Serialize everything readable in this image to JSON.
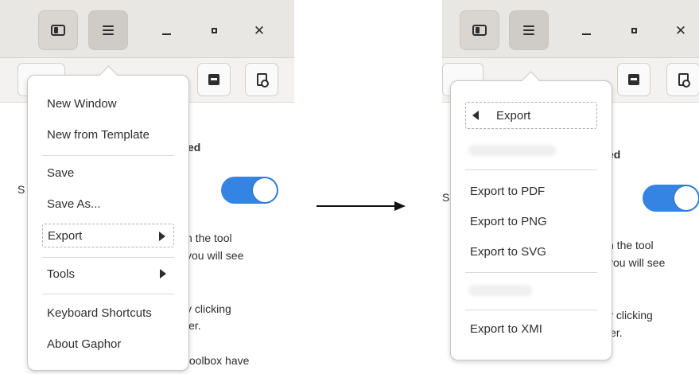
{
  "left": {
    "bg": {
      "text_ed": "ed",
      "text_s": "S",
      "text_tool": "n the tool",
      "text_see": "you will see",
      "text_clicking": "y clicking",
      "text_ler": "ler.",
      "text_toolbox": "toolbox have"
    },
    "menu": {
      "new_window": "New Window",
      "new_from_template": "New from Template",
      "save": "Save",
      "save_as": "Save As...",
      "export": "Export",
      "tools": "Tools",
      "keyboard_shortcuts": "Keyboard Shortcuts",
      "about": "About Gaphor"
    }
  },
  "right": {
    "bg": {
      "text_ed": "ed",
      "text_s": "S",
      "text_tool": "n the tool",
      "text_see": "you will see",
      "text_clicking": "y clicking",
      "text_ler": "ler."
    },
    "submenu": {
      "back_label": "Export",
      "export_pdf": "Export to PDF",
      "export_png": "Export to PNG",
      "export_svg": "Export to SVG",
      "export_xmi": "Export to XMI"
    }
  },
  "icons": [
    "sidebar-toggle-icon",
    "hamburger-menu-icon",
    "minimize-icon",
    "maximize-icon",
    "close-icon",
    "stop-icon",
    "document-search-icon",
    "chevron-right-icon",
    "chevron-left-icon",
    "arrow-right-icon"
  ],
  "colors": {
    "accent": "#3584e4",
    "headerbar": "#e9e7e4",
    "text": "#2e2e2e"
  }
}
